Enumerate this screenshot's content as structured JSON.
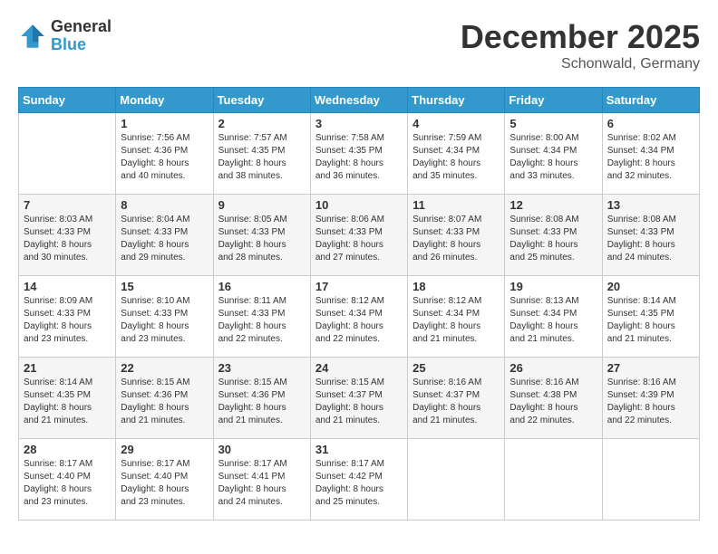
{
  "header": {
    "logo_general": "General",
    "logo_blue": "Blue",
    "month_title": "December 2025",
    "subtitle": "Schonwald, Germany"
  },
  "weekdays": [
    "Sunday",
    "Monday",
    "Tuesday",
    "Wednesday",
    "Thursday",
    "Friday",
    "Saturday"
  ],
  "weeks": [
    [
      {
        "num": "",
        "sunrise": "",
        "sunset": "",
        "daylight": ""
      },
      {
        "num": "1",
        "sunrise": "Sunrise: 7:56 AM",
        "sunset": "Sunset: 4:36 PM",
        "daylight": "Daylight: 8 hours and 40 minutes."
      },
      {
        "num": "2",
        "sunrise": "Sunrise: 7:57 AM",
        "sunset": "Sunset: 4:35 PM",
        "daylight": "Daylight: 8 hours and 38 minutes."
      },
      {
        "num": "3",
        "sunrise": "Sunrise: 7:58 AM",
        "sunset": "Sunset: 4:35 PM",
        "daylight": "Daylight: 8 hours and 36 minutes."
      },
      {
        "num": "4",
        "sunrise": "Sunrise: 7:59 AM",
        "sunset": "Sunset: 4:34 PM",
        "daylight": "Daylight: 8 hours and 35 minutes."
      },
      {
        "num": "5",
        "sunrise": "Sunrise: 8:00 AM",
        "sunset": "Sunset: 4:34 PM",
        "daylight": "Daylight: 8 hours and 33 minutes."
      },
      {
        "num": "6",
        "sunrise": "Sunrise: 8:02 AM",
        "sunset": "Sunset: 4:34 PM",
        "daylight": "Daylight: 8 hours and 32 minutes."
      }
    ],
    [
      {
        "num": "7",
        "sunrise": "Sunrise: 8:03 AM",
        "sunset": "Sunset: 4:33 PM",
        "daylight": "Daylight: 8 hours and 30 minutes."
      },
      {
        "num": "8",
        "sunrise": "Sunrise: 8:04 AM",
        "sunset": "Sunset: 4:33 PM",
        "daylight": "Daylight: 8 hours and 29 minutes."
      },
      {
        "num": "9",
        "sunrise": "Sunrise: 8:05 AM",
        "sunset": "Sunset: 4:33 PM",
        "daylight": "Daylight: 8 hours and 28 minutes."
      },
      {
        "num": "10",
        "sunrise": "Sunrise: 8:06 AM",
        "sunset": "Sunset: 4:33 PM",
        "daylight": "Daylight: 8 hours and 27 minutes."
      },
      {
        "num": "11",
        "sunrise": "Sunrise: 8:07 AM",
        "sunset": "Sunset: 4:33 PM",
        "daylight": "Daylight: 8 hours and 26 minutes."
      },
      {
        "num": "12",
        "sunrise": "Sunrise: 8:08 AM",
        "sunset": "Sunset: 4:33 PM",
        "daylight": "Daylight: 8 hours and 25 minutes."
      },
      {
        "num": "13",
        "sunrise": "Sunrise: 8:08 AM",
        "sunset": "Sunset: 4:33 PM",
        "daylight": "Daylight: 8 hours and 24 minutes."
      }
    ],
    [
      {
        "num": "14",
        "sunrise": "Sunrise: 8:09 AM",
        "sunset": "Sunset: 4:33 PM",
        "daylight": "Daylight: 8 hours and 23 minutes."
      },
      {
        "num": "15",
        "sunrise": "Sunrise: 8:10 AM",
        "sunset": "Sunset: 4:33 PM",
        "daylight": "Daylight: 8 hours and 23 minutes."
      },
      {
        "num": "16",
        "sunrise": "Sunrise: 8:11 AM",
        "sunset": "Sunset: 4:33 PM",
        "daylight": "Daylight: 8 hours and 22 minutes."
      },
      {
        "num": "17",
        "sunrise": "Sunrise: 8:12 AM",
        "sunset": "Sunset: 4:34 PM",
        "daylight": "Daylight: 8 hours and 22 minutes."
      },
      {
        "num": "18",
        "sunrise": "Sunrise: 8:12 AM",
        "sunset": "Sunset: 4:34 PM",
        "daylight": "Daylight: 8 hours and 21 minutes."
      },
      {
        "num": "19",
        "sunrise": "Sunrise: 8:13 AM",
        "sunset": "Sunset: 4:34 PM",
        "daylight": "Daylight: 8 hours and 21 minutes."
      },
      {
        "num": "20",
        "sunrise": "Sunrise: 8:14 AM",
        "sunset": "Sunset: 4:35 PM",
        "daylight": "Daylight: 8 hours and 21 minutes."
      }
    ],
    [
      {
        "num": "21",
        "sunrise": "Sunrise: 8:14 AM",
        "sunset": "Sunset: 4:35 PM",
        "daylight": "Daylight: 8 hours and 21 minutes."
      },
      {
        "num": "22",
        "sunrise": "Sunrise: 8:15 AM",
        "sunset": "Sunset: 4:36 PM",
        "daylight": "Daylight: 8 hours and 21 minutes."
      },
      {
        "num": "23",
        "sunrise": "Sunrise: 8:15 AM",
        "sunset": "Sunset: 4:36 PM",
        "daylight": "Daylight: 8 hours and 21 minutes."
      },
      {
        "num": "24",
        "sunrise": "Sunrise: 8:15 AM",
        "sunset": "Sunset: 4:37 PM",
        "daylight": "Daylight: 8 hours and 21 minutes."
      },
      {
        "num": "25",
        "sunrise": "Sunrise: 8:16 AM",
        "sunset": "Sunset: 4:37 PM",
        "daylight": "Daylight: 8 hours and 21 minutes."
      },
      {
        "num": "26",
        "sunrise": "Sunrise: 8:16 AM",
        "sunset": "Sunset: 4:38 PM",
        "daylight": "Daylight: 8 hours and 22 minutes."
      },
      {
        "num": "27",
        "sunrise": "Sunrise: 8:16 AM",
        "sunset": "Sunset: 4:39 PM",
        "daylight": "Daylight: 8 hours and 22 minutes."
      }
    ],
    [
      {
        "num": "28",
        "sunrise": "Sunrise: 8:17 AM",
        "sunset": "Sunset: 4:40 PM",
        "daylight": "Daylight: 8 hours and 23 minutes."
      },
      {
        "num": "29",
        "sunrise": "Sunrise: 8:17 AM",
        "sunset": "Sunset: 4:40 PM",
        "daylight": "Daylight: 8 hours and 23 minutes."
      },
      {
        "num": "30",
        "sunrise": "Sunrise: 8:17 AM",
        "sunset": "Sunset: 4:41 PM",
        "daylight": "Daylight: 8 hours and 24 minutes."
      },
      {
        "num": "31",
        "sunrise": "Sunrise: 8:17 AM",
        "sunset": "Sunset: 4:42 PM",
        "daylight": "Daylight: 8 hours and 25 minutes."
      },
      {
        "num": "",
        "sunrise": "",
        "sunset": "",
        "daylight": ""
      },
      {
        "num": "",
        "sunrise": "",
        "sunset": "",
        "daylight": ""
      },
      {
        "num": "",
        "sunrise": "",
        "sunset": "",
        "daylight": ""
      }
    ]
  ]
}
